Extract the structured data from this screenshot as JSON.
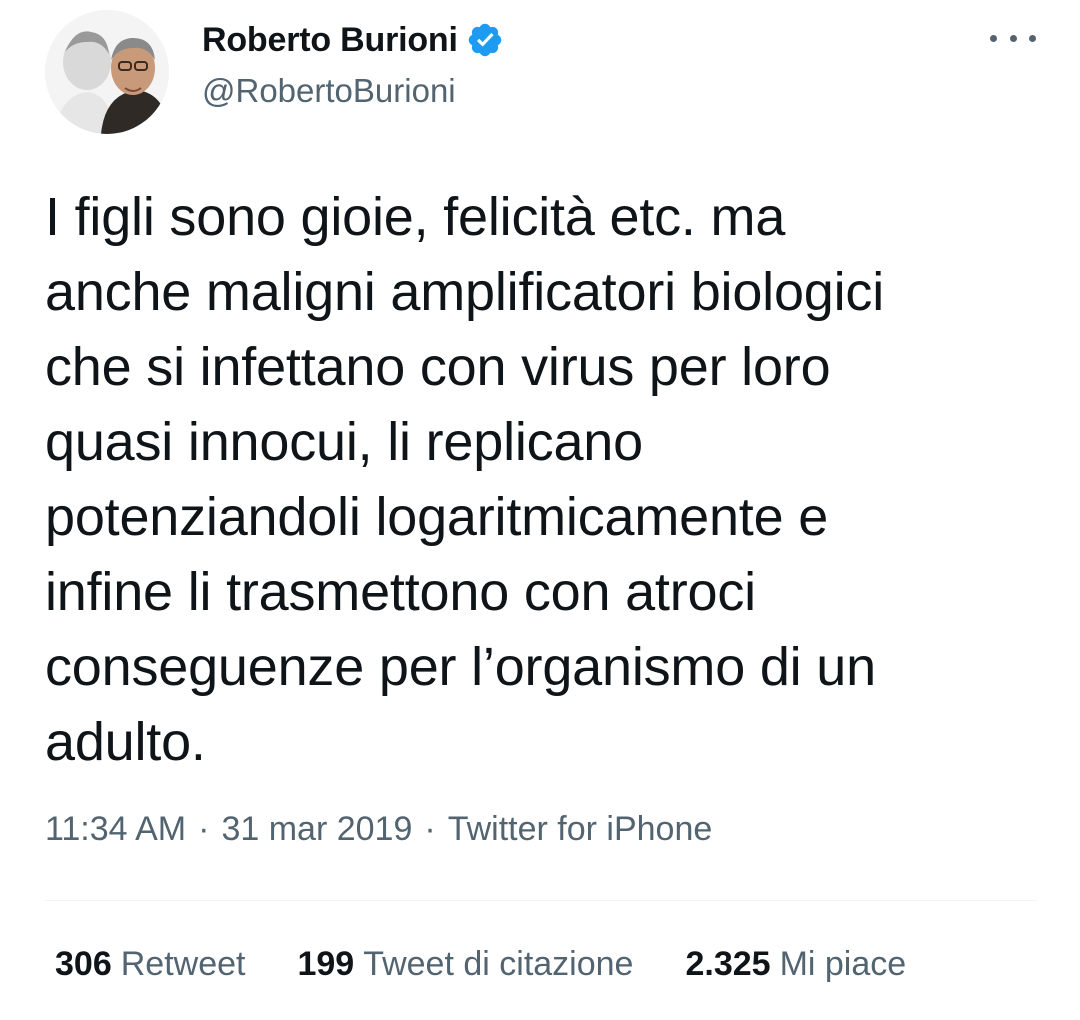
{
  "author": {
    "display_name": "Roberto Burioni",
    "handle": "@RobertoBurioni",
    "verified_icon": "verified-badge-icon",
    "avatar_icon": "profile-avatar"
  },
  "menu": {
    "icon": "more-options-icon"
  },
  "tweet": {
    "text": "I figli sono gioie, felicità etc. ma\nanche maligni amplificatori biologici\nche si infettano con virus per loro\nquasi innocui, li replicano\npotenziandoli logaritmicamente e\ninfine li trasmettono con atroci\nconseguenze per l’organismo di un\nadulto."
  },
  "meta": {
    "time": "11:34 AM",
    "separator": "·",
    "date": "31 mar 2019",
    "source": "Twitter for iPhone"
  },
  "stats": [
    {
      "count": "306",
      "label": "Retweet"
    },
    {
      "count": "199",
      "label": "Tweet di citazione"
    },
    {
      "count": "2.325",
      "label": "Mi piace"
    }
  ],
  "colors": {
    "text_primary": "#0f1419",
    "text_secondary": "#536471",
    "verified_blue": "#1d9bf0",
    "divider": "#eff3f4"
  }
}
